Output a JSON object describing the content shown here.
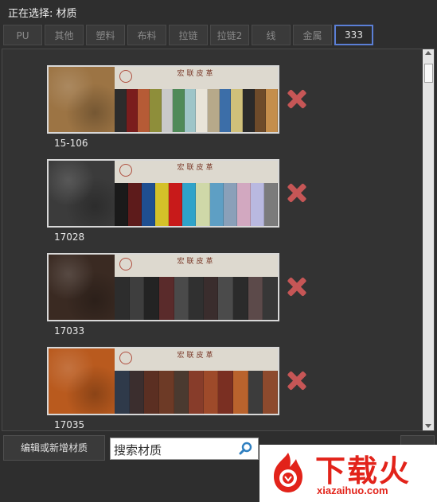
{
  "header": {
    "label": "正在选择:",
    "value": "材质"
  },
  "tabs": [
    {
      "label": "PU",
      "active": false
    },
    {
      "label": "其他",
      "active": false
    },
    {
      "label": "塑料",
      "active": false
    },
    {
      "label": "布料",
      "active": false
    },
    {
      "label": "拉链",
      "active": false
    },
    {
      "label": "拉链2",
      "active": false
    },
    {
      "label": "线",
      "active": false
    },
    {
      "label": "金属",
      "active": false
    },
    {
      "label": "333",
      "active": true
    }
  ],
  "materials": [
    {
      "code": "15-106",
      "swatch_color": "#9c7444",
      "catalog_title": "宏联皮革",
      "strip_colors": [
        "#2c2c2c",
        "#7a1d1d",
        "#b65b36",
        "#8e8e3a",
        "#c9c9c9",
        "#4f8a58",
        "#9ec5c8",
        "#e9e4d8",
        "#b7a98a",
        "#3c6ea8",
        "#d0c07a",
        "#2a2a2a",
        "#6e4b2a",
        "#c58e4c"
      ]
    },
    {
      "code": "17028",
      "swatch_color": "#3b3b3b",
      "catalog_title": "宏联皮革",
      "strip_colors": [
        "#1a1a1a",
        "#5d1b1b",
        "#1f4f91",
        "#d4c129",
        "#c81a1a",
        "#2fa3c9",
        "#cfd8a8",
        "#5e9fc4",
        "#8aa0b9",
        "#d2a8c0",
        "#b9b9e0",
        "#7b7b7b"
      ]
    },
    {
      "code": "17033",
      "swatch_color": "#3a2a22",
      "catalog_title": "宏联皮革",
      "strip_colors": [
        "#2d2d2d",
        "#3e3e3e",
        "#232323",
        "#5a2b2b",
        "#4a4a4a",
        "#303030",
        "#3a2d2d",
        "#4b4b4b",
        "#2b2b2b",
        "#5c4a4a",
        "#373737"
      ]
    },
    {
      "code": "17035",
      "swatch_color": "#b95a1e",
      "catalog_title": "宏联皮革",
      "strip_colors": [
        "#2f3a4a",
        "#3b2e2e",
        "#5b2f22",
        "#6d3a26",
        "#4a3a30",
        "#873c2a",
        "#9e4a2a",
        "#7a2f22",
        "#b9632d",
        "#3c3c3c",
        "#8d4a2d"
      ]
    }
  ],
  "footer": {
    "edit_button": "编辑或新增材质",
    "search_placeholder": "搜索材质",
    "search_value": "搜索材质"
  },
  "watermark": {
    "text": "下载火",
    "url": "xiazaihuo.com"
  }
}
